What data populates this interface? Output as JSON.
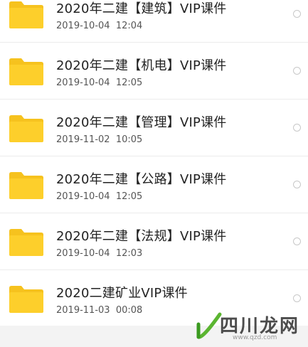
{
  "files": [
    {
      "name": "2020年二建【建筑】VIP课件",
      "date": "2019-10-04",
      "time": "12:04"
    },
    {
      "name": "2020年二建【机电】VIP课件",
      "date": "2019-10-04",
      "time": "12:05"
    },
    {
      "name": "2020年二建【管理】VIP课件",
      "date": "2019-11-02",
      "time": "10:05"
    },
    {
      "name": "2020年二建【公路】VIP课件",
      "date": "2019-10-04",
      "time": "12:05"
    },
    {
      "name": "2020年二建【法规】VIP课件",
      "date": "2019-10-04",
      "time": "12:03"
    },
    {
      "name": "2020二建矿业VIP课件",
      "date": "2019-11-03",
      "time": "00:08"
    }
  ],
  "icons": {
    "folder": "folder-icon",
    "select": "radio-circle-icon"
  },
  "colors": {
    "folder": "#fdcf2b",
    "folder_tab": "#f6c21e",
    "text": "#222222",
    "meta": "#555555"
  },
  "watermark": {
    "text": "四川龙网",
    "url": "www.qzd.com"
  }
}
